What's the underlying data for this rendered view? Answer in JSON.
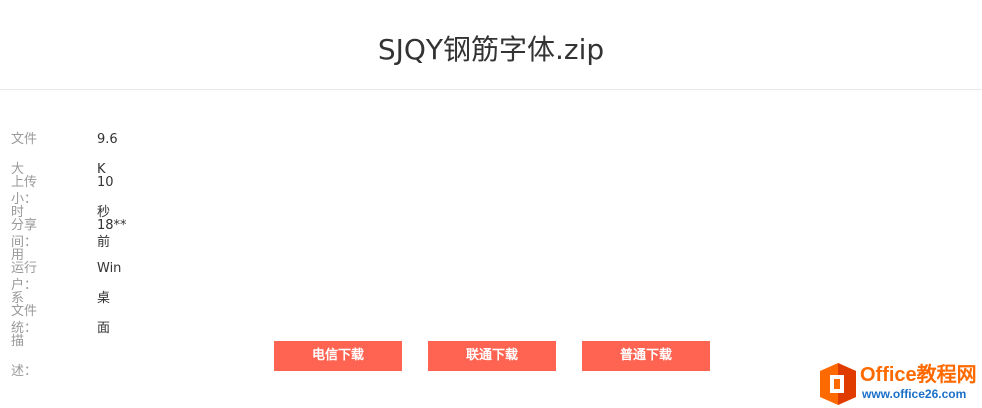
{
  "header": {
    "title": "SJQY钢筋字体.zip"
  },
  "info": {
    "rows": [
      {
        "label": "文件大小：",
        "value": "9.6 K"
      },
      {
        "label": "上传时间：",
        "value": "10 秒前"
      },
      {
        "label": "分享用户：",
        "value": "18**"
      },
      {
        "label": "运行系统：",
        "value": "Win桌面"
      },
      {
        "label": "文件描述：",
        "value": ""
      }
    ]
  },
  "downloads": {
    "telecom_label": "电信下载",
    "unicom_label": "联通下载",
    "normal_label": "普通下载"
  },
  "watermark": {
    "brand": "Office教程网",
    "url": "www.office26.com",
    "icon": "office-logo-icon"
  },
  "colors": {
    "button_bg": "#ff6452",
    "label": "#999999",
    "value": "#333333",
    "brand_orange": "#ff6a00",
    "brand_blue": "#1a6fc9"
  }
}
